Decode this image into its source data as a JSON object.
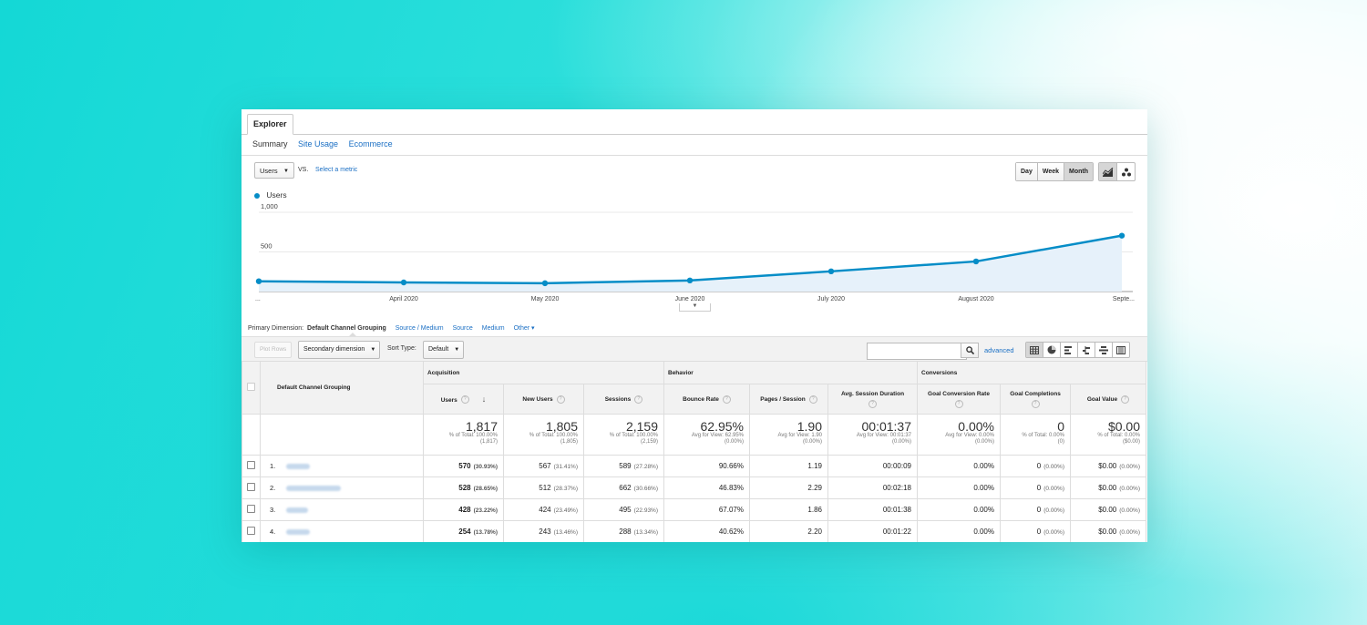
{
  "tab": {
    "explorer": "Explorer"
  },
  "subtabs": {
    "summary": "Summary",
    "site_usage": "Site Usage",
    "ecommerce": "Ecommerce"
  },
  "metric": {
    "selected": "Users",
    "vs": "VS.",
    "select_metric": "Select a metric"
  },
  "periods": {
    "day": "Day",
    "week": "Week",
    "month": "Month",
    "active": "Month"
  },
  "chart_data": {
    "type": "area",
    "series": [
      {
        "name": "Users",
        "values": [
          130,
          115,
          105,
          140,
          255,
          380,
          705
        ],
        "color": "#058dc7"
      }
    ],
    "x": [
      "...",
      "April 2020",
      "May 2020",
      "June 2020",
      "July 2020",
      "August 2020",
      "Septe..."
    ],
    "ylim": [
      0,
      1000
    ],
    "y_ticks": [
      "1,000",
      "500"
    ],
    "grid": true,
    "legend": "top-left"
  },
  "dimension": {
    "label": "Primary Dimension:",
    "selected": "Default Channel Grouping",
    "options": [
      "Source / Medium",
      "Source",
      "Medium",
      "Other"
    ]
  },
  "toolbar": {
    "plot_rows": "Plot Rows",
    "secondary_dimension": "Secondary dimension",
    "sort_type_label": "Sort Type:",
    "sort_type": "Default",
    "advanced": "advanced",
    "search_value": ""
  },
  "table": {
    "dimension_header": "Default Channel Grouping",
    "groups": {
      "acquisition": "Acquisition",
      "behavior": "Behavior",
      "conversions": "Conversions"
    },
    "columns": {
      "users": "Users",
      "new_users": "New Users",
      "sessions": "Sessions",
      "bounce_rate": "Bounce Rate",
      "pages_session": "Pages / Session",
      "avg_session_duration": "Avg. Session Duration",
      "goal_conv_rate": "Goal Conversion Rate",
      "goal_completions": "Goal Completions",
      "goal_value": "Goal Value"
    },
    "totals": {
      "users": {
        "value": "1,817",
        "line1": "% of Total: 100.00%",
        "line2": "(1,817)"
      },
      "new_users": {
        "value": "1,805",
        "line1": "% of Total: 100.00%",
        "line2": "(1,805)"
      },
      "sessions": {
        "value": "2,159",
        "line1": "% of Total: 100.00%",
        "line2": "(2,159)"
      },
      "bounce_rate": {
        "value": "62.95%",
        "line1": "Avg for View: 62.95%",
        "line2": "(0.00%)"
      },
      "pages_session": {
        "value": "1.90",
        "line1": "Avg for View: 1.90",
        "line2": "(0.00%)"
      },
      "avg_session_duration": {
        "value": "00:01:37",
        "line1": "Avg for View: 00:01:37",
        "line2": "(0.00%)"
      },
      "goal_conv_rate": {
        "value": "0.00%",
        "line1": "Avg for View: 0.00%",
        "line2": "(0.00%)"
      },
      "goal_completions": {
        "value": "0",
        "line1": "% of Total: 0.00%",
        "line2": "(0)"
      },
      "goal_value": {
        "value": "$0.00",
        "line1": "% of Total: 0.00%",
        "line2": "($0.00)"
      }
    },
    "rows": [
      {
        "index": "1.",
        "users": "570",
        "users_pct": "(30.93%)",
        "new_users": "567",
        "new_users_pct": "(31.41%)",
        "sessions": "589",
        "sessions_pct": "(27.28%)",
        "bounce_rate": "90.66%",
        "pages_session": "1.19",
        "avg_duration": "00:00:09",
        "goal_conv": "0.00%",
        "goal_comp": "0",
        "goal_comp_pct": "(0.00%)",
        "goal_value": "$0.00",
        "goal_value_pct": "(0.00%)"
      },
      {
        "index": "2.",
        "users": "528",
        "users_pct": "(28.65%)",
        "new_users": "512",
        "new_users_pct": "(28.37%)",
        "sessions": "662",
        "sessions_pct": "(30.66%)",
        "bounce_rate": "46.83%",
        "pages_session": "2.29",
        "avg_duration": "00:02:18",
        "goal_conv": "0.00%",
        "goal_comp": "0",
        "goal_comp_pct": "(0.00%)",
        "goal_value": "$0.00",
        "goal_value_pct": "(0.00%)"
      },
      {
        "index": "3.",
        "users": "428",
        "users_pct": "(23.22%)",
        "new_users": "424",
        "new_users_pct": "(23.49%)",
        "sessions": "495",
        "sessions_pct": "(22.93%)",
        "bounce_rate": "67.07%",
        "pages_session": "1.86",
        "avg_duration": "00:01:38",
        "goal_conv": "0.00%",
        "goal_comp": "0",
        "goal_comp_pct": "(0.00%)",
        "goal_value": "$0.00",
        "goal_value_pct": "(0.00%)"
      },
      {
        "index": "4.",
        "users": "254",
        "users_pct": "(13.78%)",
        "new_users": "243",
        "new_users_pct": "(13.46%)",
        "sessions": "288",
        "sessions_pct": "(13.34%)",
        "bounce_rate": "40.62%",
        "pages_session": "2.20",
        "avg_duration": "00:01:22",
        "goal_conv": "0.00%",
        "goal_comp": "0",
        "goal_comp_pct": "(0.00%)",
        "goal_value": "$0.00",
        "goal_value_pct": "(0.00%)"
      }
    ]
  },
  "icons": {
    "search": "search-icon",
    "line_chart": "line-chart-icon",
    "motion_chart": "motion-chart-icon",
    "table_views": [
      "table-view-icon",
      "pie-view-icon",
      "performance-view-icon",
      "comparison-view-icon",
      "term-cloud-icon",
      "pivot-view-icon"
    ]
  },
  "colors": {
    "accent": "#058dc7",
    "link": "#1a6fc4"
  }
}
